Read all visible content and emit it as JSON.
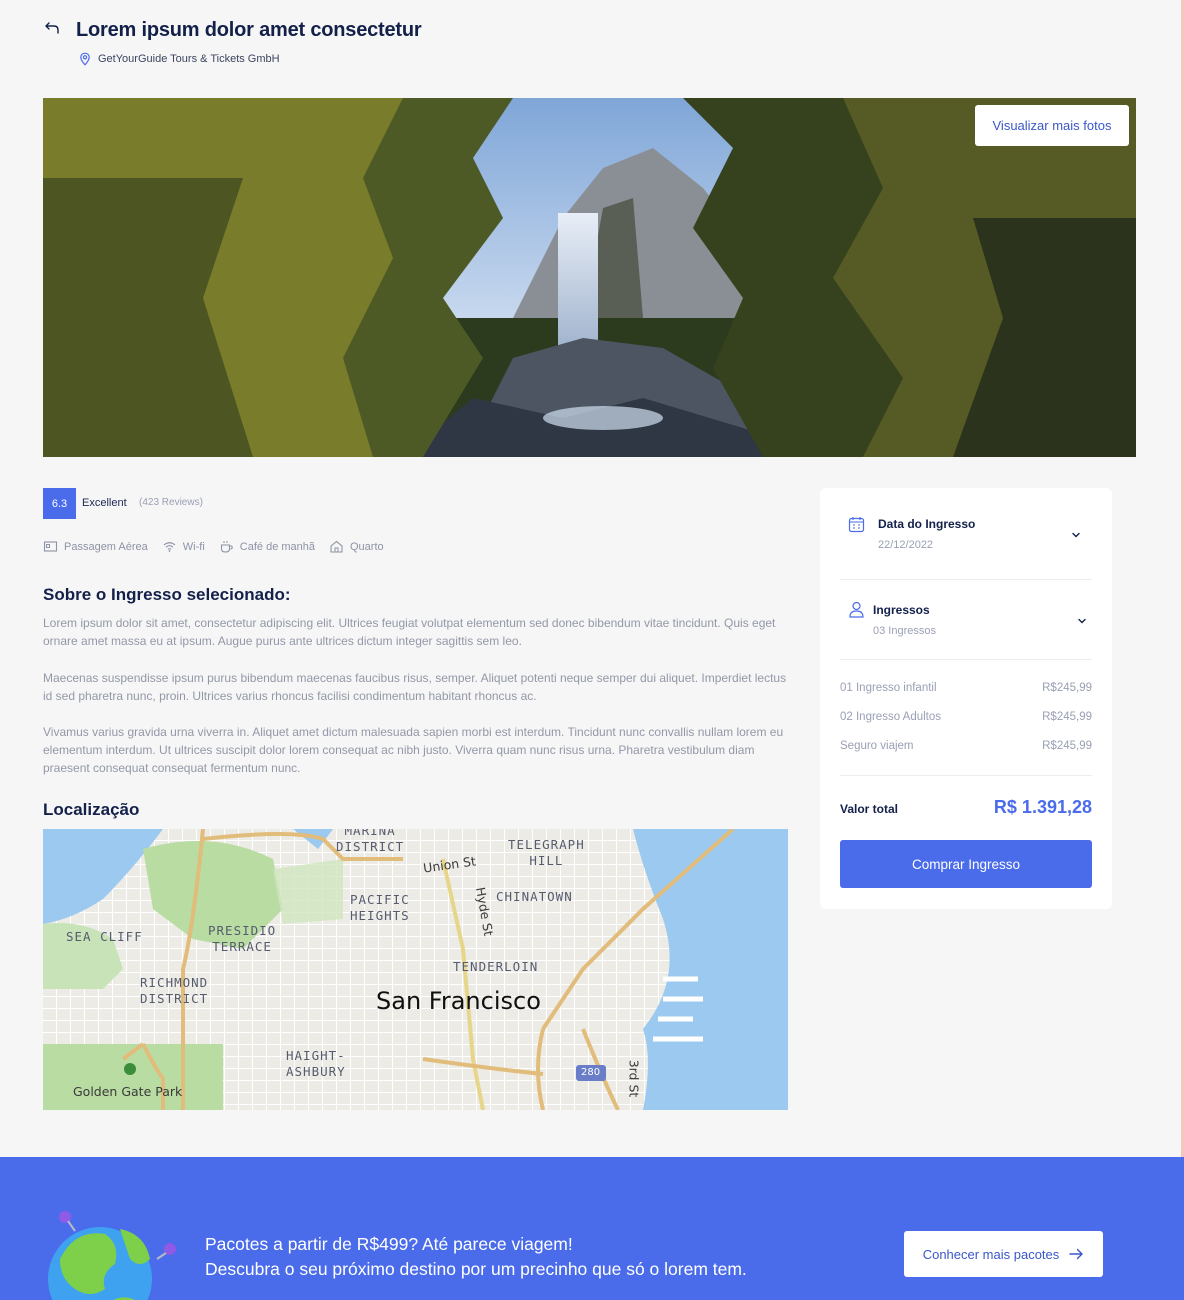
{
  "header": {
    "title": "Lorem ipsum dolor amet consectetur",
    "location": "GetYourGuide Tours & Tickets GmbH"
  },
  "hero": {
    "more_photos_label": "Visualizar mais fotos"
  },
  "rating": {
    "score": "6.3",
    "label": "Excellent",
    "reviews": "(423 Reviews)"
  },
  "amenities": [
    {
      "icon": "ticket-icon",
      "label": "Passagem Aérea"
    },
    {
      "icon": "wifi-icon",
      "label": "Wi-fi"
    },
    {
      "icon": "coffee-icon",
      "label": "Café de manhã"
    },
    {
      "icon": "home-icon",
      "label": "Quarto"
    }
  ],
  "about": {
    "title": "Sobre o Ingresso selecionado:",
    "paragraphs": [
      "Lorem ipsum dolor sit amet, consectetur adipiscing elit. Ultrices feugiat volutpat elementum sed donec bibendum vitae tincidunt. Quis eget ornare amet massa eu at ipsum. Augue purus ante ultrices dictum integer sagittis sem leo.",
      "Maecenas suspendisse ipsum purus bibendum maecenas faucibus risus, semper. Aliquet potenti neque semper dui aliquet. Imperdiet lectus id sed pharetra nunc, proin. Ultrices varius rhoncus facilisi condimentum habitant rhoncus ac.",
      "Vivamus varius gravida urna viverra in. Aliquet amet dictum malesuada sapien morbi est interdum. Tincidunt nunc convallis nullam lorem eu elementum interdum. Ut ultrices suscipit dolor lorem consequat ac nibh justo. Viverra quam nunc risus urna. Pharetra vestibulum diam praesent consequat consequat fermentum nunc."
    ]
  },
  "location": {
    "title": "Localização",
    "map": {
      "city": "San Francisco",
      "districts": {
        "marina": "MARINA\nDISTRICT",
        "telegraph": "TELEGRAPH\nHILL",
        "pacific": "PACIFIC\nHEIGHTS",
        "chinatown": "CHINATOWN",
        "seacliff": "SEA CLIFF",
        "presidio": "PRESIDIO\nTERRACE",
        "tenderloin": "TENDERLOIN",
        "richmond": "RICHMOND\nDISTRICT",
        "haight": "HAIGHT-\nASHBURY"
      },
      "streets": {
        "union": "Union St",
        "hyde": "Hyde St",
        "third": "3rd St",
        "park": "Golden Gate Park",
        "highway": "280"
      }
    }
  },
  "booking": {
    "date_label": "Data do Ingresso",
    "date_value": "22/12/2022",
    "tickets_label": "Ingressos",
    "tickets_value": "03 Ingressos",
    "items": [
      {
        "label": "01 Ingresso infantil",
        "price": "R$245,99"
      },
      {
        "label": "02 Ingresso Adultos",
        "price": "R$245,99"
      },
      {
        "label": "Seguro viajem",
        "price": "R$245,99"
      }
    ],
    "total_label": "Valor total",
    "total_value": "R$ 1.391,28",
    "buy_label": "Comprar Ingresso"
  },
  "banner": {
    "line1": "Pacotes a partir de R$499? Até parece viagem!",
    "line2": "Descubra o seu próximo destino por um precinho que só o lorem tem.",
    "button_label": "Conhecer mais pacotes"
  },
  "colors": {
    "accent": "#4a6bea",
    "title": "#13204a",
    "muted": "#9398a8",
    "background": "#f6f6f6"
  }
}
